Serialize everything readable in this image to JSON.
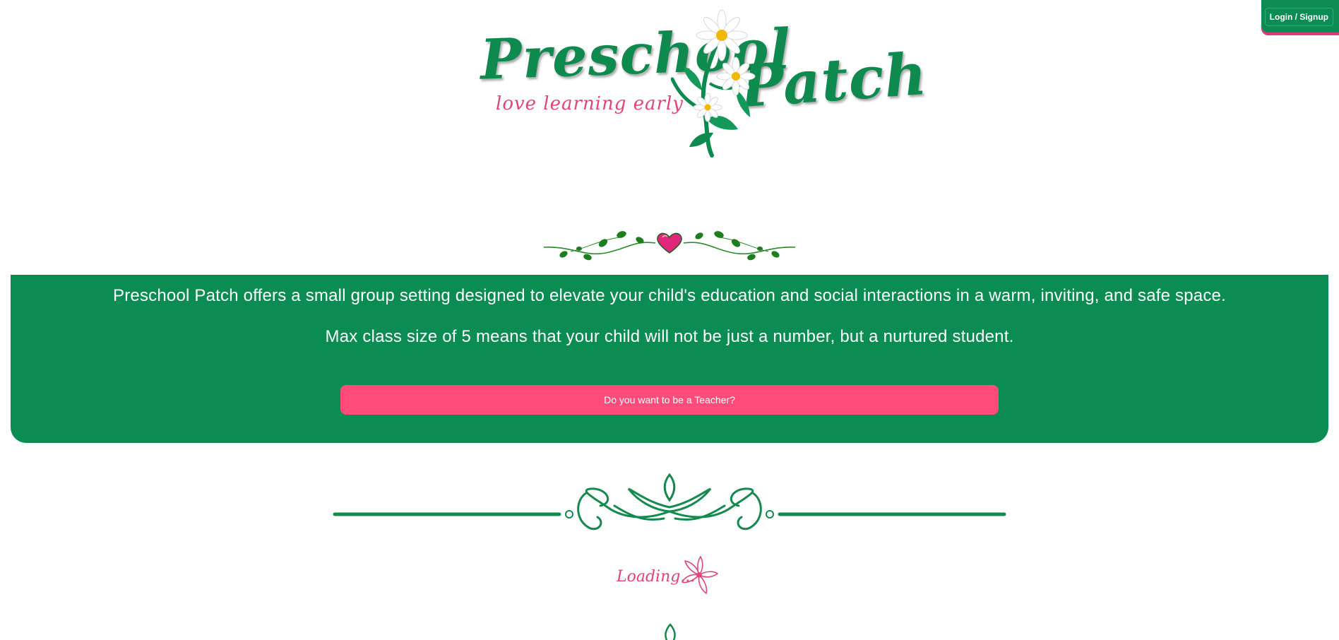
{
  "header": {
    "login_label": "Login / Signup"
  },
  "logo": {
    "word1": "Preschool",
    "word2": "Patch",
    "tagline": "love learning early"
  },
  "intro": {
    "line1": "Preschool Patch offers a small group setting designed to elevate your child's education and social interactions in a warm, inviting, and safe space.",
    "line2": "Max class size of 5 means that your child will not be just a number, but a nurtured student.",
    "teacher_button_label": "Do you want to be a Teacher?"
  },
  "loading": {
    "text": "Loading..."
  },
  "colors": {
    "brand_green": "#0b8c52",
    "accent_pink": "#ff4b7a",
    "tagline_pink": "#e0447a"
  },
  "icons": {
    "logo_flower": "daisy-flower-icon",
    "vine": "heart-vine-icon",
    "divider": "ornamental-divider-icon",
    "loading": "lily-flower-icon"
  }
}
